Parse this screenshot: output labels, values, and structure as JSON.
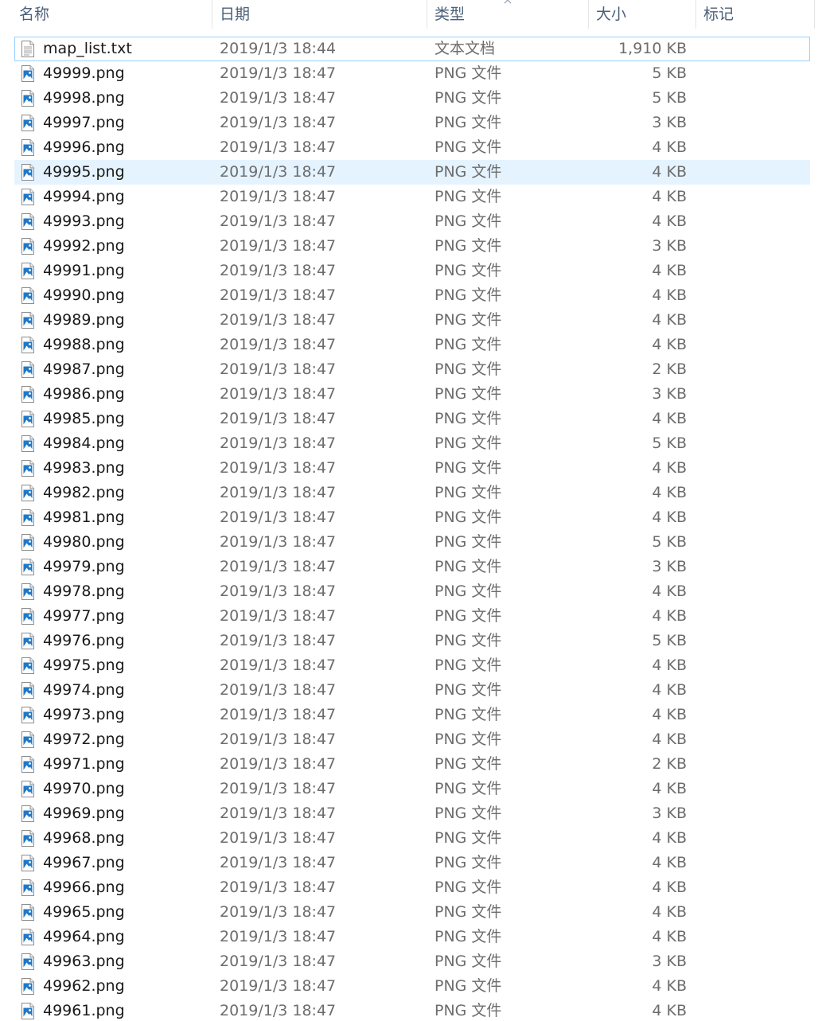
{
  "columns": {
    "name": "名称",
    "date": "日期",
    "type": "类型",
    "size": "大小",
    "tags": "标记"
  },
  "files": [
    {
      "name": "map_list.txt",
      "date": "2019/1/3 18:44",
      "type": "文本文档",
      "size": "1,910 KB",
      "icon": "text-file-icon"
    },
    {
      "name": "49999.png",
      "date": "2019/1/3 18:47",
      "type": "PNG 文件",
      "size": "5 KB",
      "icon": "image-file-icon"
    },
    {
      "name": "49998.png",
      "date": "2019/1/3 18:47",
      "type": "PNG 文件",
      "size": "5 KB",
      "icon": "image-file-icon"
    },
    {
      "name": "49997.png",
      "date": "2019/1/3 18:47",
      "type": "PNG 文件",
      "size": "3 KB",
      "icon": "image-file-icon"
    },
    {
      "name": "49996.png",
      "date": "2019/1/3 18:47",
      "type": "PNG 文件",
      "size": "4 KB",
      "icon": "image-file-icon"
    },
    {
      "name": "49995.png",
      "date": "2019/1/3 18:47",
      "type": "PNG 文件",
      "size": "4 KB",
      "icon": "image-file-icon"
    },
    {
      "name": "49994.png",
      "date": "2019/1/3 18:47",
      "type": "PNG 文件",
      "size": "4 KB",
      "icon": "image-file-icon"
    },
    {
      "name": "49993.png",
      "date": "2019/1/3 18:47",
      "type": "PNG 文件",
      "size": "4 KB",
      "icon": "image-file-icon"
    },
    {
      "name": "49992.png",
      "date": "2019/1/3 18:47",
      "type": "PNG 文件",
      "size": "3 KB",
      "icon": "image-file-icon"
    },
    {
      "name": "49991.png",
      "date": "2019/1/3 18:47",
      "type": "PNG 文件",
      "size": "4 KB",
      "icon": "image-file-icon"
    },
    {
      "name": "49990.png",
      "date": "2019/1/3 18:47",
      "type": "PNG 文件",
      "size": "4 KB",
      "icon": "image-file-icon"
    },
    {
      "name": "49989.png",
      "date": "2019/1/3 18:47",
      "type": "PNG 文件",
      "size": "4 KB",
      "icon": "image-file-icon"
    },
    {
      "name": "49988.png",
      "date": "2019/1/3 18:47",
      "type": "PNG 文件",
      "size": "4 KB",
      "icon": "image-file-icon"
    },
    {
      "name": "49987.png",
      "date": "2019/1/3 18:47",
      "type": "PNG 文件",
      "size": "2 KB",
      "icon": "image-file-icon"
    },
    {
      "name": "49986.png",
      "date": "2019/1/3 18:47",
      "type": "PNG 文件",
      "size": "3 KB",
      "icon": "image-file-icon"
    },
    {
      "name": "49985.png",
      "date": "2019/1/3 18:47",
      "type": "PNG 文件",
      "size": "4 KB",
      "icon": "image-file-icon"
    },
    {
      "name": "49984.png",
      "date": "2019/1/3 18:47",
      "type": "PNG 文件",
      "size": "5 KB",
      "icon": "image-file-icon"
    },
    {
      "name": "49983.png",
      "date": "2019/1/3 18:47",
      "type": "PNG 文件",
      "size": "4 KB",
      "icon": "image-file-icon"
    },
    {
      "name": "49982.png",
      "date": "2019/1/3 18:47",
      "type": "PNG 文件",
      "size": "4 KB",
      "icon": "image-file-icon"
    },
    {
      "name": "49981.png",
      "date": "2019/1/3 18:47",
      "type": "PNG 文件",
      "size": "4 KB",
      "icon": "image-file-icon"
    },
    {
      "name": "49980.png",
      "date": "2019/1/3 18:47",
      "type": "PNG 文件",
      "size": "5 KB",
      "icon": "image-file-icon"
    },
    {
      "name": "49979.png",
      "date": "2019/1/3 18:47",
      "type": "PNG 文件",
      "size": "3 KB",
      "icon": "image-file-icon"
    },
    {
      "name": "49978.png",
      "date": "2019/1/3 18:47",
      "type": "PNG 文件",
      "size": "4 KB",
      "icon": "image-file-icon"
    },
    {
      "name": "49977.png",
      "date": "2019/1/3 18:47",
      "type": "PNG 文件",
      "size": "4 KB",
      "icon": "image-file-icon"
    },
    {
      "name": "49976.png",
      "date": "2019/1/3 18:47",
      "type": "PNG 文件",
      "size": "5 KB",
      "icon": "image-file-icon"
    },
    {
      "name": "49975.png",
      "date": "2019/1/3 18:47",
      "type": "PNG 文件",
      "size": "4 KB",
      "icon": "image-file-icon"
    },
    {
      "name": "49974.png",
      "date": "2019/1/3 18:47",
      "type": "PNG 文件",
      "size": "4 KB",
      "icon": "image-file-icon"
    },
    {
      "name": "49973.png",
      "date": "2019/1/3 18:47",
      "type": "PNG 文件",
      "size": "4 KB",
      "icon": "image-file-icon"
    },
    {
      "name": "49972.png",
      "date": "2019/1/3 18:47",
      "type": "PNG 文件",
      "size": "4 KB",
      "icon": "image-file-icon"
    },
    {
      "name": "49971.png",
      "date": "2019/1/3 18:47",
      "type": "PNG 文件",
      "size": "2 KB",
      "icon": "image-file-icon"
    },
    {
      "name": "49970.png",
      "date": "2019/1/3 18:47",
      "type": "PNG 文件",
      "size": "4 KB",
      "icon": "image-file-icon"
    },
    {
      "name": "49969.png",
      "date": "2019/1/3 18:47",
      "type": "PNG 文件",
      "size": "3 KB",
      "icon": "image-file-icon"
    },
    {
      "name": "49968.png",
      "date": "2019/1/3 18:47",
      "type": "PNG 文件",
      "size": "4 KB",
      "icon": "image-file-icon"
    },
    {
      "name": "49967.png",
      "date": "2019/1/3 18:47",
      "type": "PNG 文件",
      "size": "4 KB",
      "icon": "image-file-icon"
    },
    {
      "name": "49966.png",
      "date": "2019/1/3 18:47",
      "type": "PNG 文件",
      "size": "4 KB",
      "icon": "image-file-icon"
    },
    {
      "name": "49965.png",
      "date": "2019/1/3 18:47",
      "type": "PNG 文件",
      "size": "4 KB",
      "icon": "image-file-icon"
    },
    {
      "name": "49964.png",
      "date": "2019/1/3 18:47",
      "type": "PNG 文件",
      "size": "4 KB",
      "icon": "image-file-icon"
    },
    {
      "name": "49963.png",
      "date": "2019/1/3 18:47",
      "type": "PNG 文件",
      "size": "3 KB",
      "icon": "image-file-icon"
    },
    {
      "name": "49962.png",
      "date": "2019/1/3 18:47",
      "type": "PNG 文件",
      "size": "4 KB",
      "icon": "image-file-icon"
    },
    {
      "name": "49961.png",
      "date": "2019/1/3 18:47",
      "type": "PNG 文件",
      "size": "4 KB",
      "icon": "image-file-icon"
    }
  ],
  "focused_index": 0,
  "selected_index": 5,
  "sort_indicator": "chevron-up-icon",
  "colors": {
    "header_text": "#4c607a",
    "selection_bg": "#e5f3ff",
    "focus_border": "#99d1ff",
    "image_icon_blue": "#1e78c8"
  }
}
